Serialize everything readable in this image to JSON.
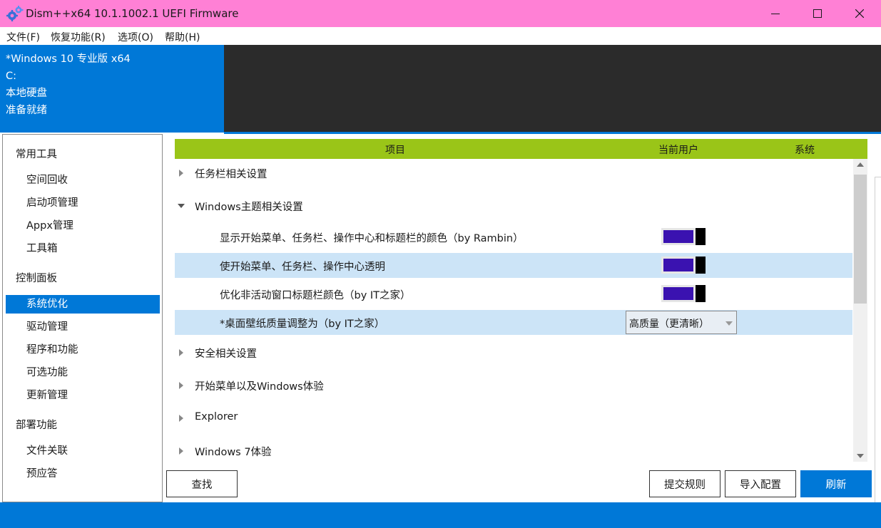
{
  "window": {
    "title": "Dism++x64 10.1.1002.1 UEFI Firmware",
    "icon": "gears-icon"
  },
  "menu": [
    {
      "label": "文件(F)"
    },
    {
      "label": "恢复功能(R)"
    },
    {
      "label": "选项(O)"
    },
    {
      "label": "帮助(H)"
    }
  ],
  "info": {
    "os": "*Windows 10 专业版 x64",
    "drive": "C:",
    "disk": "本地硬盘",
    "status": "准备就绪"
  },
  "sidebar": {
    "groups": [
      {
        "title": "常用工具",
        "items": [
          "空间回收",
          "启动项管理",
          "Appx管理",
          "工具箱"
        ]
      },
      {
        "title": "控制面板",
        "items": [
          "系统优化",
          "驱动管理",
          "程序和功能",
          "可选功能",
          "更新管理"
        ]
      },
      {
        "title": "部署功能",
        "items": [
          "文件关联",
          "预应答"
        ]
      }
    ],
    "active": "系统优化"
  },
  "table": {
    "columns": [
      "项目",
      "当前用户",
      "系统"
    ],
    "groups": [
      {
        "label": "任务栏相关设置",
        "expanded": false
      },
      {
        "label": "Windows主题相关设置",
        "expanded": true
      },
      {
        "label": "安全相关设置",
        "expanded": false
      },
      {
        "label": "开始菜单以及Windows体验",
        "expanded": false
      },
      {
        "label": "Explorer",
        "expanded": false
      },
      {
        "label": "Windows 7体验",
        "expanded": false
      }
    ],
    "settings": [
      {
        "label": "显示开始菜单、任务栏、操作中心和标题栏的颜色（by Rambin）",
        "control": "toggle",
        "on": true
      },
      {
        "label": "使开始菜单、任务栏、操作中心透明",
        "control": "toggle",
        "on": true
      },
      {
        "label": "优化非活动窗口标题栏颜色（by IT之家）",
        "control": "toggle",
        "on": true
      },
      {
        "label": "*桌面壁纸质量调整为（by IT之家）",
        "control": "dropdown",
        "value": "高质量（更清晰）"
      }
    ]
  },
  "buttons": {
    "find": "查找",
    "submit_rules": "提交规则",
    "import_config": "导入配置",
    "refresh": "刷新"
  },
  "colors": {
    "title_bar": "#ff80d5",
    "accent": "#0078d7",
    "header_green": "#9ac518",
    "toggle_on": "#3a12b0",
    "row_highlight": "#cce4f7"
  }
}
